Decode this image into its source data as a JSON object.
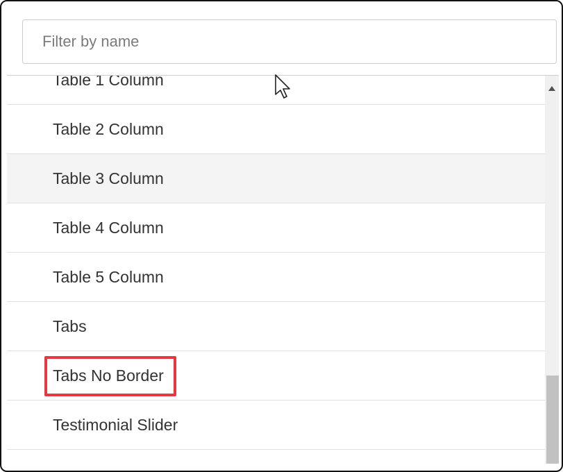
{
  "filter": {
    "placeholder": "Filter by name",
    "value": ""
  },
  "list": {
    "items": [
      {
        "label": "Table 1 Column"
      },
      {
        "label": "Table 2 Column"
      },
      {
        "label": "Table 3 Column"
      },
      {
        "label": "Table 4 Column"
      },
      {
        "label": "Table 5 Column"
      },
      {
        "label": "Tabs"
      },
      {
        "label": "Tabs No Border"
      },
      {
        "label": "Testimonial Slider"
      }
    ],
    "hovered_item": "Table 3 Column",
    "highlighted_item": "Tabs No Border"
  },
  "colors": {
    "highlight_box": "#e5393f",
    "hover_row": "#f4f4f4",
    "scrollbar_thumb": "#c1c1c1"
  },
  "icons": {
    "scroll_up": "triangle-up-icon",
    "cursor": "mouse-pointer-icon"
  }
}
